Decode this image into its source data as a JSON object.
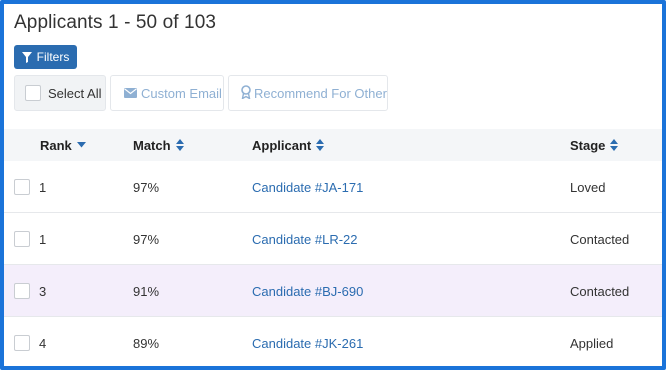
{
  "header": {
    "title": "Applicants 1 - 50 of 103"
  },
  "toolbar": {
    "filters_label": "Filters",
    "select_all_label": "Select All",
    "custom_email_label": "Custom Email",
    "recommend_label": "Recommend For Other"
  },
  "table": {
    "columns": {
      "rank": "Rank",
      "match": "Match",
      "applicant": "Applicant",
      "stage": "Stage"
    },
    "rows": [
      {
        "rank": "1",
        "match": "97%",
        "applicant": "Candidate #JA-171",
        "stage": "Loved"
      },
      {
        "rank": "1",
        "match": "97%",
        "applicant": "Candidate #LR-22",
        "stage": "Contacted"
      },
      {
        "rank": "3",
        "match": "91%",
        "applicant": "Candidate #BJ-690",
        "stage": "Contacted"
      },
      {
        "rank": "4",
        "match": "89%",
        "applicant": "Candidate #JK-261",
        "stage": "Applied"
      }
    ]
  },
  "colors": {
    "accent": "#2b6cb0",
    "frame": "#1a73d9",
    "highlight_row": "#f4eefb",
    "disabled_text": "#8fb0d3"
  },
  "icons": {
    "filters": "funnel-icon",
    "email": "envelope-icon",
    "recommend": "award-icon",
    "rank_sort": "caret-down-icon",
    "sort": "sort-icon"
  }
}
